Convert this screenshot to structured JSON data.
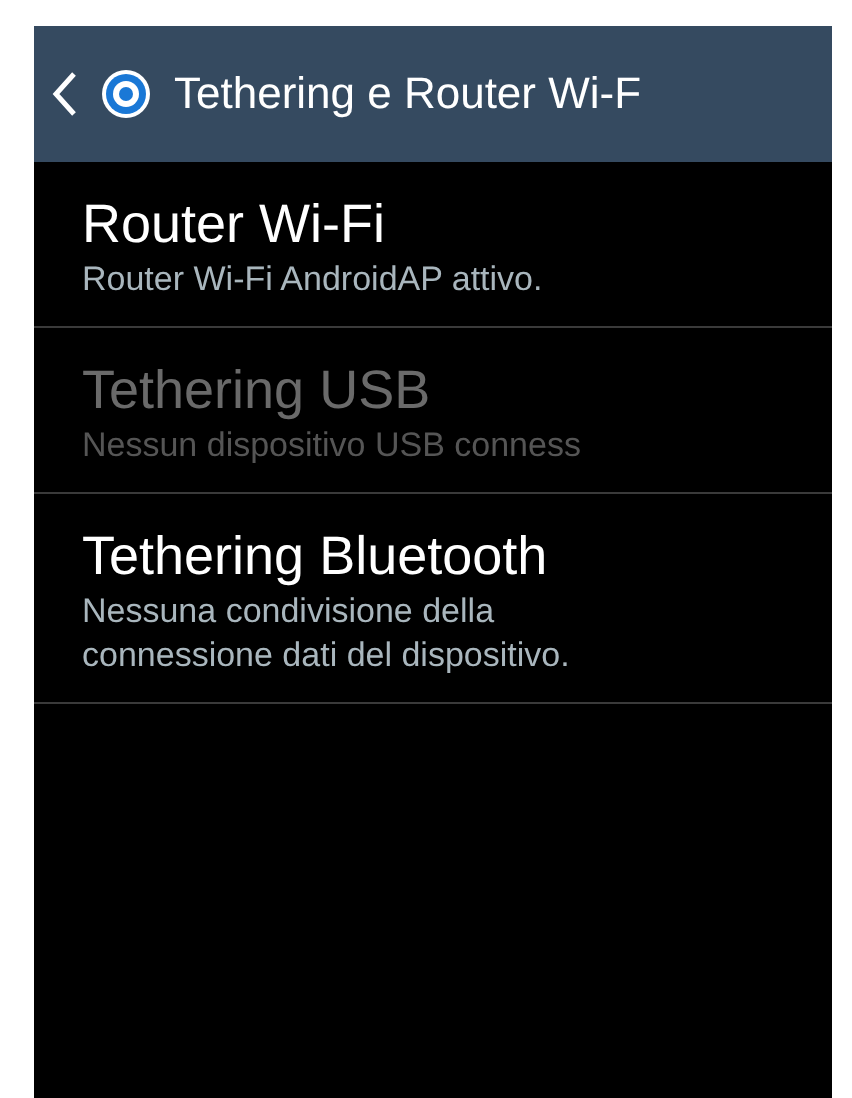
{
  "action_bar": {
    "title": "Tethering e Router Wi-F"
  },
  "items": [
    {
      "title": "Router Wi-Fi",
      "summary": "Router Wi-Fi AndroidAP attivo.",
      "disabled": false
    },
    {
      "title": "Tethering USB",
      "summary": "Nessun dispositivo USB conness",
      "disabled": true
    },
    {
      "title": "Tethering Bluetooth",
      "summary": "Nessuna condivisione della connessione dati del dispositivo.",
      "disabled": false
    }
  ]
}
